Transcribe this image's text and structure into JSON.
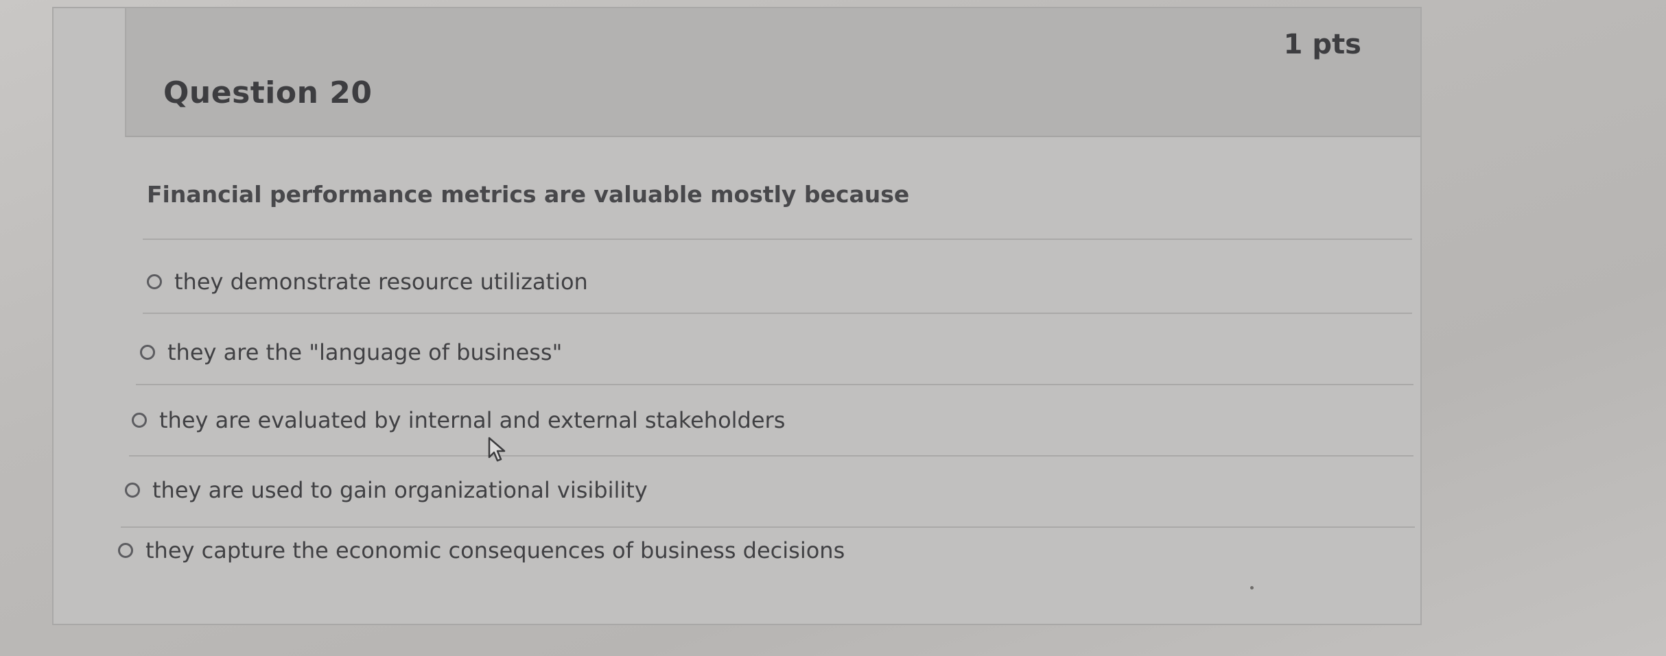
{
  "question": {
    "title": "Question 20",
    "points": "1 pts",
    "prompt": "Financial performance metrics are valuable mostly because"
  },
  "answers": [
    {
      "label": "they demonstrate resource utilization"
    },
    {
      "label": "they are the \"language of business\""
    },
    {
      "label": "they are evaluated by internal and external stakeholders"
    },
    {
      "label": "they are used to gain organizational visibility"
    },
    {
      "label": "they capture the economic consequences of business decisions"
    }
  ],
  "icons": {
    "flag": "flag-icon",
    "radio": "radio-button-icon",
    "cursor": "mouse-pointer-icon"
  },
  "colors": {
    "background": "#bdbbb9",
    "card": "#c1c0bf",
    "header": "#b3b2b1",
    "text": "#3d3d40"
  }
}
